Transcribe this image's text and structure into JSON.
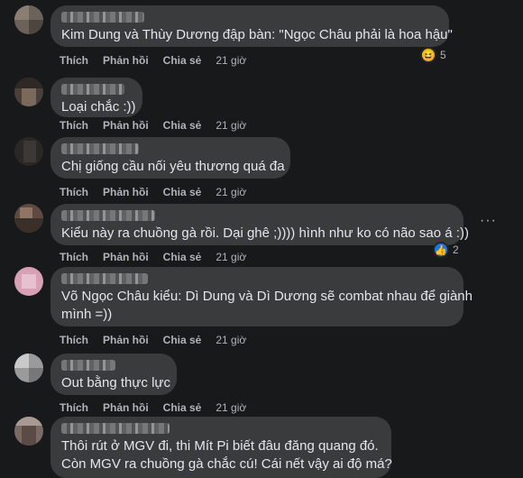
{
  "comments": [
    {
      "text_lines": [
        "Kim Dung và Thùy Dương đập bàn: \"Ngọc Châu phải là hoa hậu\""
      ],
      "actions": {
        "like": "Thích",
        "reply": "Phản hồi",
        "share": "Chia sẻ",
        "time": "21 giờ"
      },
      "reaction": {
        "icon": "haha-icon",
        "count": "5"
      }
    },
    {
      "text_lines": [
        "Loại chắc :))"
      ],
      "actions": {
        "like": "Thích",
        "reply": "Phản hồi",
        "share": "Chia sẻ",
        "time": "21 giờ"
      }
    },
    {
      "text_lines": [
        "Chị giống cầu nối yêu thương quá đa"
      ],
      "actions": {
        "like": "Thích",
        "reply": "Phản hồi",
        "share": "Chia sẻ",
        "time": "21 giờ"
      }
    },
    {
      "text_lines": [
        "Kiểu này ra chuồng gà rồi. Dại ghê ;)))) hình như ko có não sao á :))"
      ],
      "actions": {
        "like": "Thích",
        "reply": "Phản hồi",
        "share": "Chia sẻ",
        "time": "21 giờ"
      },
      "reaction": {
        "icon": "like-icon",
        "count": "2"
      }
    },
    {
      "text_lines": [
        "Võ Ngọc Châu kiểu: Dì Dung và Dì Dương sẽ combat nhau để giành",
        "mình =))"
      ],
      "actions": {
        "like": "Thích",
        "reply": "Phản hồi",
        "share": "Chia sẻ",
        "time": "21 giờ"
      }
    },
    {
      "text_lines": [
        "Out bằng thực lực"
      ],
      "actions": {
        "like": "Thích",
        "reply": "Phản hồi",
        "share": "Chia sẻ",
        "time": "21 giờ"
      }
    },
    {
      "text_lines": [
        "Thôi rút ở MGV đi, thi Mít Pi biết đâu đăng quang đó.",
        "Còn MGV ra chuồng gà chắc cú! Cái nết vậy ai độ má?"
      ]
    }
  ],
  "colors": {
    "background": "#18191a",
    "bubble": "#3a3b3c",
    "text": "#e4e6eb",
    "secondary_text": "#b0b3b8",
    "like_blue": "#1877f2",
    "haha_yellow": "#f7b125"
  }
}
